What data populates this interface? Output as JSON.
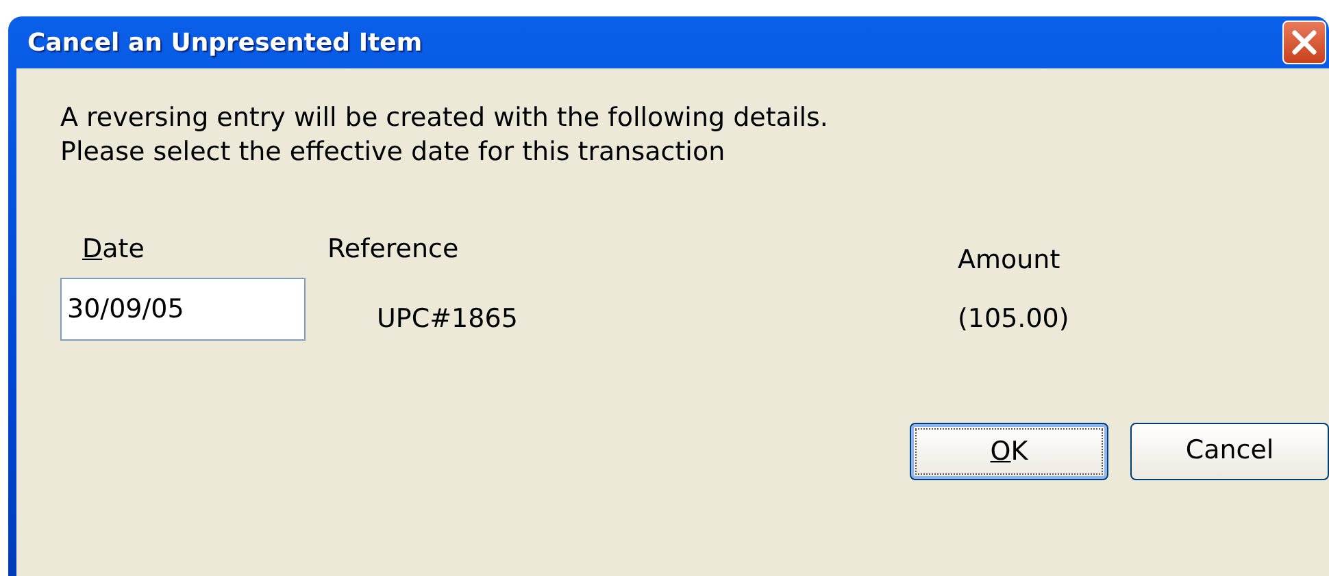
{
  "window": {
    "title": "Cancel an Unpresented Item"
  },
  "message": [
    "A reversing entry will be created with the following details.",
    "Please select the effective date for this transaction"
  ],
  "fields": {
    "date": {
      "label": "Date",
      "underline_first": true,
      "value": "30/09/05"
    },
    "reference": {
      "label": "Reference",
      "value": "UPC#1865"
    },
    "amount": {
      "label": "Amount",
      "value": "(105.00)"
    }
  },
  "buttons": [
    {
      "label": "OK",
      "default": true,
      "underline_first": true
    },
    {
      "label": "Cancel",
      "default": false,
      "underline_first": false
    }
  ]
}
